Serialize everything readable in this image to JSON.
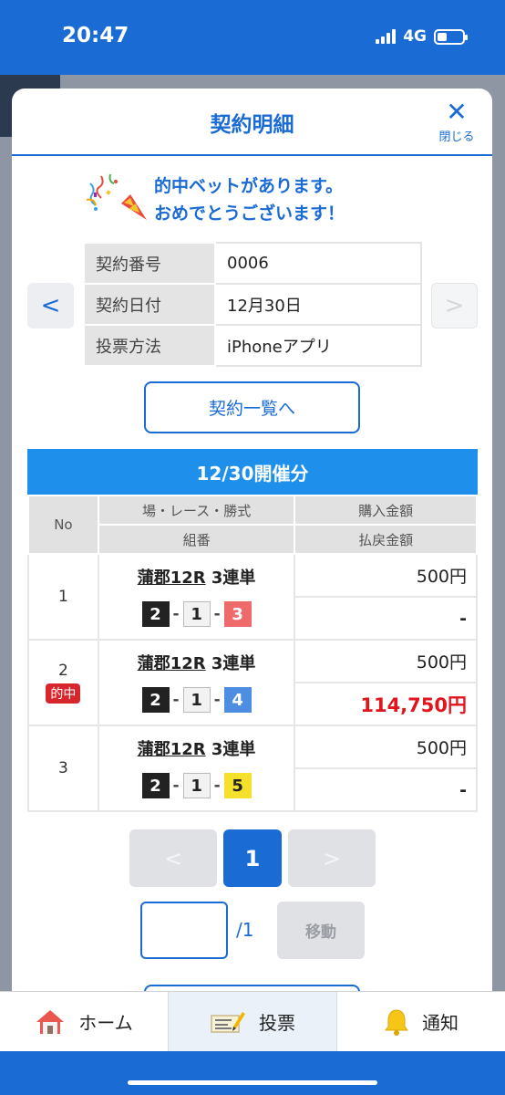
{
  "status_bar": {
    "time": "20:47",
    "network": "4G"
  },
  "modal": {
    "title": "契約明細",
    "close_label": "閉じる",
    "congrats_line1": "的中ベットがあります。",
    "congrats_line2": "おめでとうございます！",
    "nav_prev": "<",
    "nav_next": ">",
    "info": [
      {
        "label": "契約番号",
        "value": "0006"
      },
      {
        "label": "契約日付",
        "value": "12月30日"
      },
      {
        "label": "投票方法",
        "value": "iPhoneアプリ"
      }
    ],
    "list_button": "契約一覧へ",
    "day_header": "12/30開催分",
    "table_headers": {
      "no": "No",
      "race": "場・レース・勝式",
      "combo": "組番",
      "purchase": "購入金額",
      "payout": "払戻金額"
    },
    "bets": [
      {
        "no": "1",
        "place": "蒲郡12R",
        "type": "3連単",
        "combo": [
          "2",
          "1",
          "3"
        ],
        "purchase": "500円",
        "payout": "-",
        "hit": false
      },
      {
        "no": "2",
        "place": "蒲郡12R",
        "type": "3連単",
        "combo": [
          "2",
          "1",
          "4"
        ],
        "purchase": "500円",
        "payout": "114,750円",
        "hit": true,
        "hit_label": "的中"
      },
      {
        "no": "3",
        "place": "蒲郡12R",
        "type": "3連単",
        "combo": [
          "2",
          "1",
          "5"
        ],
        "purchase": "500円",
        "payout": "-",
        "hit": false
      }
    ],
    "combo_separator": "-",
    "pager": {
      "prev": "<",
      "current": "1",
      "next": ">",
      "total": "/1",
      "move_button": "移動",
      "input_value": ""
    }
  },
  "tabbar": {
    "home": "ホーム",
    "vote": "投票",
    "notify": "通知"
  },
  "colors": {
    "brand": "#1a6bd4",
    "hit_red": "#e0161c",
    "day_header": "#1e90ec"
  }
}
